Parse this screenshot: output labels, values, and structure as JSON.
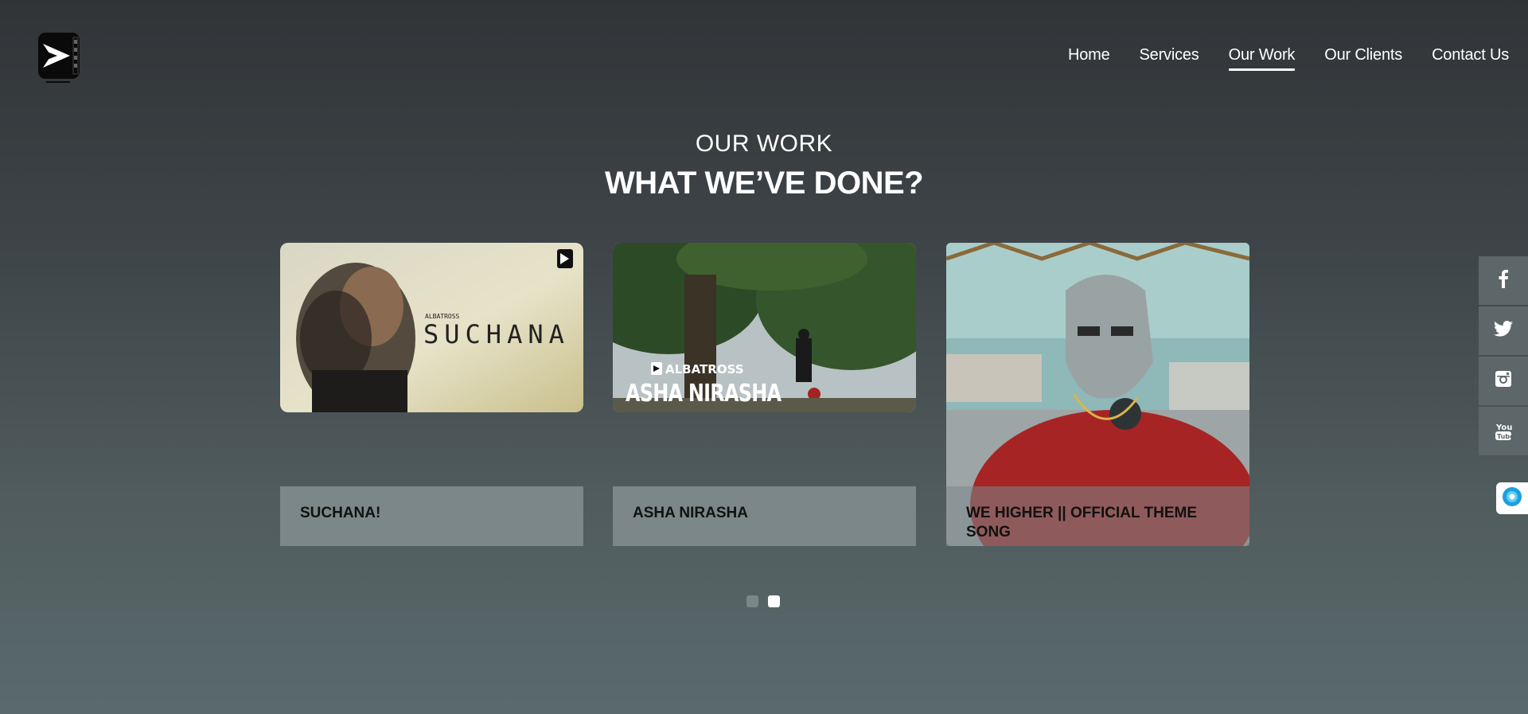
{
  "nav": {
    "items": [
      {
        "label": "Home",
        "active": false
      },
      {
        "label": "Services",
        "active": false
      },
      {
        "label": "Our Work",
        "active": true
      },
      {
        "label": "Our Clients",
        "active": false
      },
      {
        "label": "Contact Us",
        "active": false
      }
    ]
  },
  "section": {
    "kicker": "OUR WORK",
    "heading": "WHAT WE’VE DONE?"
  },
  "cards": [
    {
      "caption": "SUCHANA!",
      "thumb_text": "SUCHANA",
      "thumb_small": "ALBATROSS"
    },
    {
      "caption": "ASHA NIRASHA",
      "thumb_text": "ASHA NIRASHA",
      "thumb_small": "ALBATROSS"
    },
    {
      "caption": "WE HIGHER || OFFICIAL THEME SONG"
    }
  ],
  "carousel": {
    "pages": 2,
    "current": 2
  },
  "social": {
    "icons": [
      "facebook-icon",
      "twitter-icon",
      "instagram-icon",
      "youtube-icon"
    ],
    "youtube_text": "You Tube"
  },
  "colors": {
    "accent": "#ffffff",
    "caption_bg": "#7b8788",
    "social_bg": "#5d6769",
    "chat_icon": "#1e9fe0"
  }
}
